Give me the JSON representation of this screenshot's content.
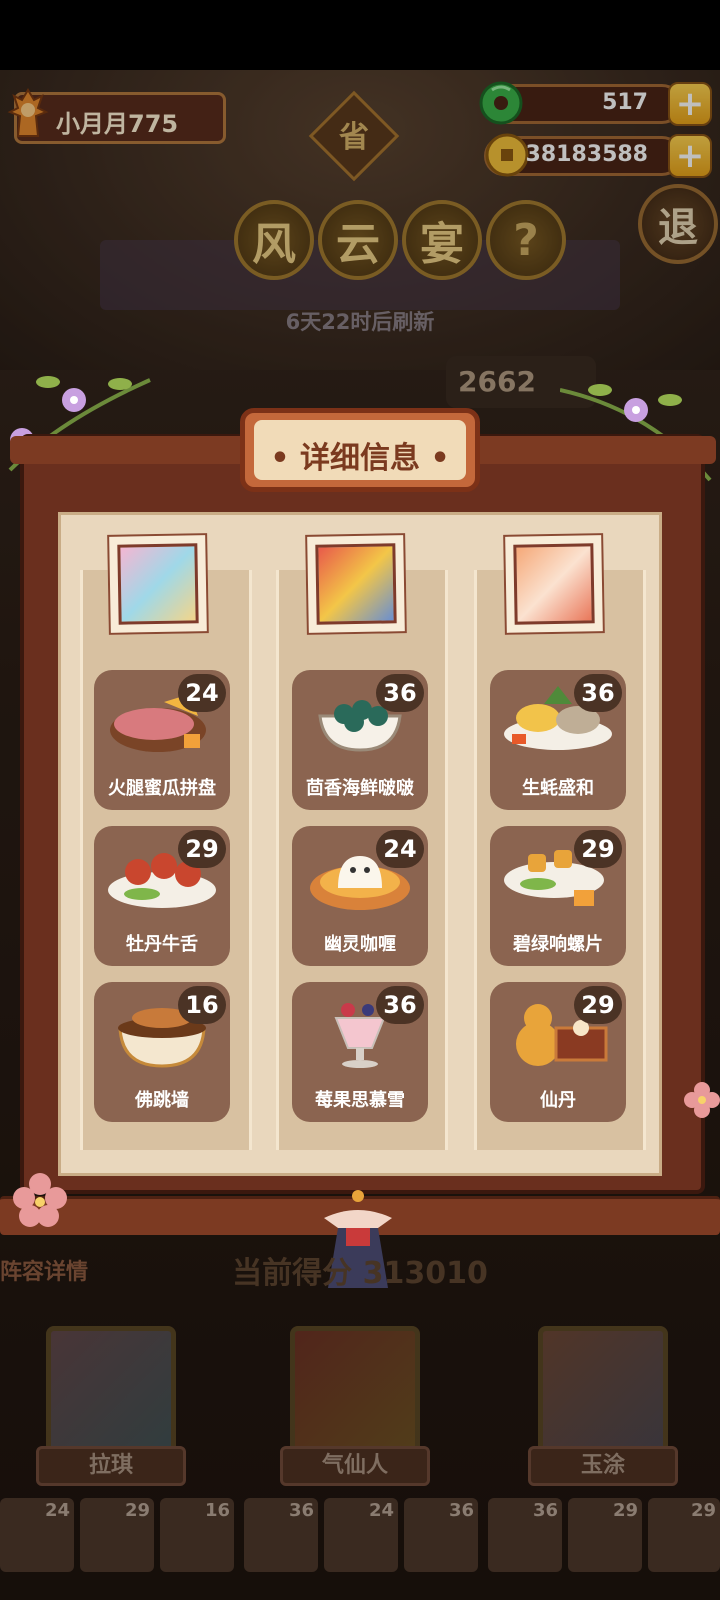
{
  "player": {
    "name": "小月月775"
  },
  "currency": {
    "jade": "517",
    "coins": "38183588"
  },
  "header": {
    "seal": "省",
    "title_chars": [
      "风",
      "云",
      "宴"
    ],
    "help": "?",
    "exit": "退",
    "refresh": "6天22时后刷新",
    "score_partial": "2662"
  },
  "panel": {
    "title": "详细信息",
    "columns": [
      {
        "dishes": [
          {
            "name": "火腿蜜瓜拼盘",
            "count": "24"
          },
          {
            "name": "牡丹牛舌",
            "count": "29"
          },
          {
            "name": "佛跳墙",
            "count": "16"
          }
        ]
      },
      {
        "dishes": [
          {
            "name": "茴香海鲜啵啵",
            "count": "36"
          },
          {
            "name": "幽灵咖喱",
            "count": "24"
          },
          {
            "name": "莓果思慕雪",
            "count": "36"
          }
        ]
      },
      {
        "dishes": [
          {
            "name": "生蚝盛和",
            "count": "36"
          },
          {
            "name": "碧绿响螺片",
            "count": "29"
          },
          {
            "name": "仙丹",
            "count": "29"
          }
        ]
      }
    ]
  },
  "bottom": {
    "lineup_label": "阵容详情",
    "current_score": "当前得分 313010",
    "heroes": [
      "拉琪",
      "气仙人",
      "玉涂"
    ],
    "mini_counts": [
      "24",
      "29",
      "16",
      "36",
      "24",
      "36",
      "36",
      "29",
      "29"
    ]
  },
  "colors": {
    "panel_frame": "#6a2f1e",
    "panel_paper": "#e9d7bd",
    "dish_card": "#8b6450",
    "gold": "#e9a41a"
  }
}
